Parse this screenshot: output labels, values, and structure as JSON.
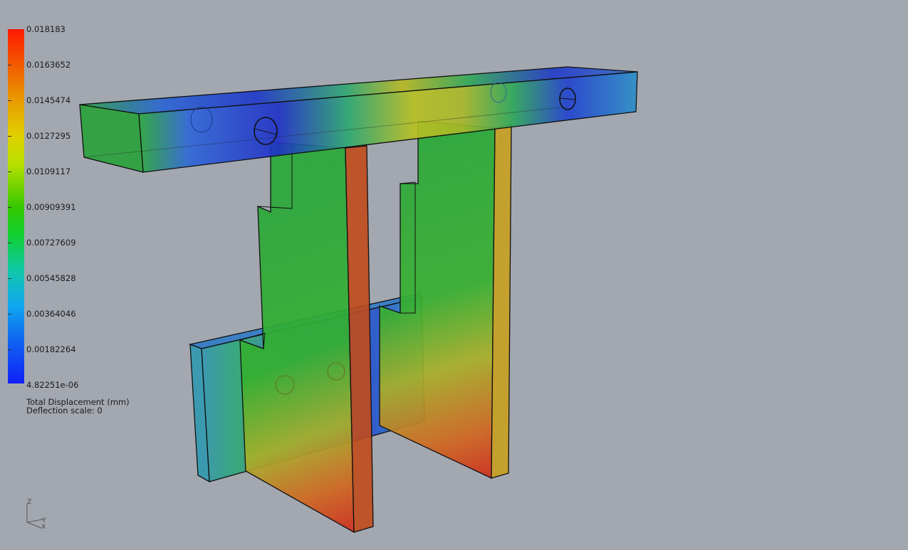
{
  "legend": {
    "ticks": [
      "0.018183",
      "0.0163652",
      "0.0145474",
      "0.0127295",
      "0.0109117",
      "0.00909391",
      "0.00727609",
      "0.00545828",
      "0.00364046",
      "0.00182264",
      "4.82251e-06"
    ],
    "caption_line1": "Total Displacement (mm)",
    "caption_line2": "Deflection scale: 0"
  },
  "axes": {
    "z": "Z",
    "y": "Y",
    "x": "X"
  },
  "colors": {
    "background": "#a3a8b0",
    "scale_max": "#ff1a00",
    "scale_mid": "#38c800",
    "scale_min": "#1020f8"
  }
}
